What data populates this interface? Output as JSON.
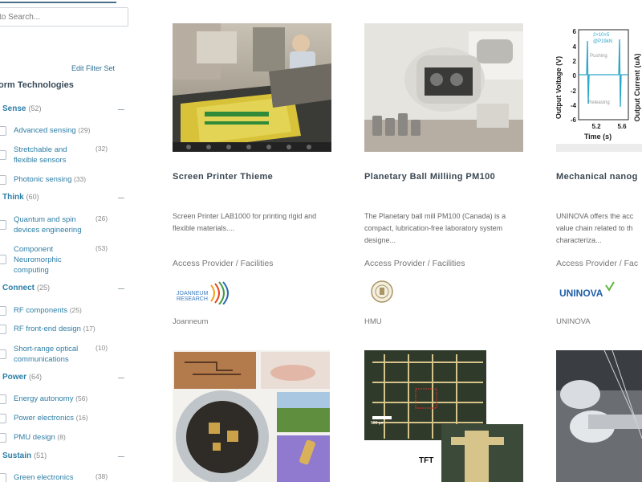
{
  "search": {
    "placeholder": "to Search..."
  },
  "sidebar": {
    "edit_filter": "Edit Filter Set",
    "section_title": "orm Technologies",
    "categories": [
      {
        "label": "Sense",
        "count": "(52)"
      },
      {
        "label": "Think",
        "count": "(60)"
      },
      {
        "label": "Connect",
        "count": "(25)"
      },
      {
        "label": "Power",
        "count": "(64)"
      },
      {
        "label": "Sustain",
        "count": "(51)"
      }
    ],
    "items": [
      {
        "label": "Advanced sensing",
        "count": "(29)"
      },
      {
        "label": "Stretchable and flexible sensors",
        "count": "(32)"
      },
      {
        "label": "Photonic sensing",
        "count": "(33)"
      },
      {
        "label": "Quantum and spin devices engineering",
        "count": "(26)"
      },
      {
        "label": "Component Neuromorphic computing",
        "count": "(53)"
      },
      {
        "label": "RF components",
        "count": "(25)"
      },
      {
        "label": "RF front-end design",
        "count": "(17)"
      },
      {
        "label": "Short-range optical communications",
        "count": "(10)"
      },
      {
        "label": "Energy autonomy",
        "count": "(56)"
      },
      {
        "label": "Power electronics",
        "count": "(16)"
      },
      {
        "label": "PMU design",
        "count": "(8)"
      },
      {
        "label": "Green electronics",
        "count": "(38)"
      }
    ]
  },
  "cards": [
    {
      "title": "Screen Printer Thieme",
      "description": "Screen Printer LAB1000 for printing rigid and flexible materials....",
      "access_label": "Access Provider / Facilities",
      "logo_text": "JOANNEUM RESEARCH",
      "org": "Joanneum"
    },
    {
      "title": "Planetary Ball Milliing PM100",
      "description": "The Planetary ball mill PM100 (Canada) is a compact, lubrication-free laboratory system designe...",
      "access_label": "Access Provider / Facilities",
      "logo_text": "",
      "org": "HMU"
    },
    {
      "title": "Mechanical nanog",
      "description": "UNINOVA offers the acc value chain related to th characteriza...",
      "access_label": "Access Provider / Fac",
      "logo_text": "UNINOVA",
      "org": "UNINOVA"
    }
  ],
  "chart": {
    "ylabel_left": "Output Voltage (V)",
    "ylabel_right": "Output Current (uA)",
    "xlabel": "Time (s)",
    "yticks": [
      "6",
      "4",
      "2",
      "0",
      "-2",
      "-4",
      "-6"
    ],
    "xticks": [
      "5.2",
      "5.6"
    ],
    "legend1": "2×10×5",
    "legend2": "@P19kN",
    "annot_top": "Pushing",
    "annot_bottom": "Releasing"
  },
  "tft_label": "TFT",
  "scale_label": "500 μm",
  "colors": {
    "accent": "#2d7ea6",
    "title": "#3b4752",
    "muted": "#777777"
  }
}
